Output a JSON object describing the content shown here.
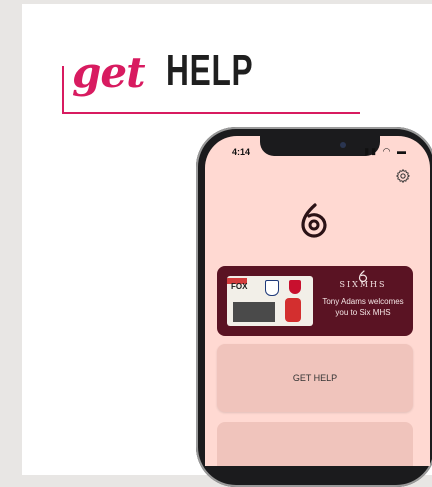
{
  "heading": {
    "script_word": "get",
    "bold_word": "HELP"
  },
  "phone": {
    "status_time": "4:14",
    "status_icons": "▮▮ ◠ ▬"
  },
  "welcome_card": {
    "brand": "SIXMHS",
    "message": "Tony Adams welcomes you to Six MHS",
    "thumb_label": "FOX"
  },
  "buttons": {
    "get_help": "GET HELP"
  },
  "icons": {
    "settings": "gear-icon",
    "logo": "six-mhs-logo-icon",
    "collapse": "chevron-up-icon"
  },
  "colors": {
    "accent": "#d81b60",
    "screen_bg": "#ffd9d2",
    "card_bg": "#5a1323",
    "button_bg": "#f0c4bc"
  }
}
